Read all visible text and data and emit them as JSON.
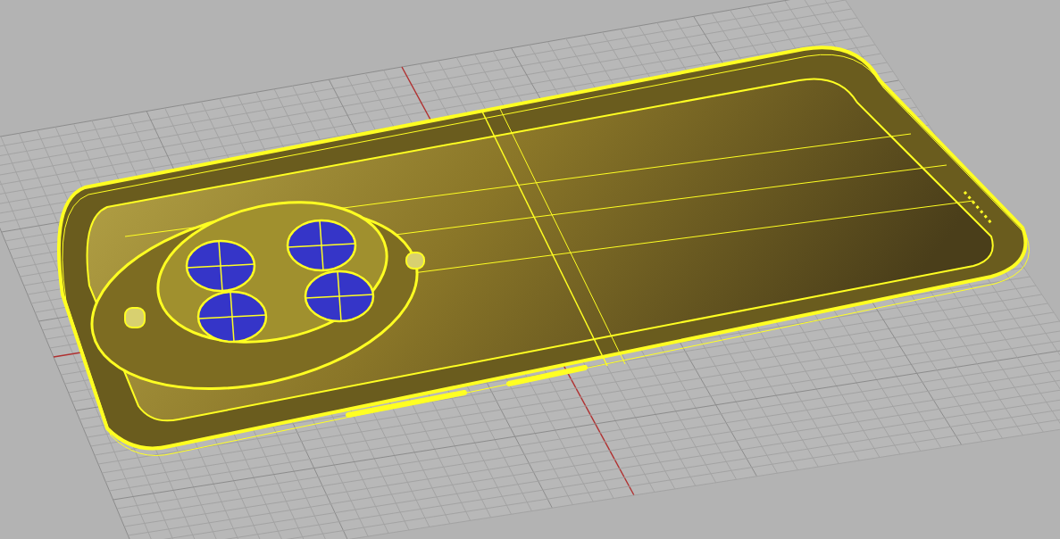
{
  "viewport": {
    "grid": true
  },
  "model": {
    "selected": true
  }
}
